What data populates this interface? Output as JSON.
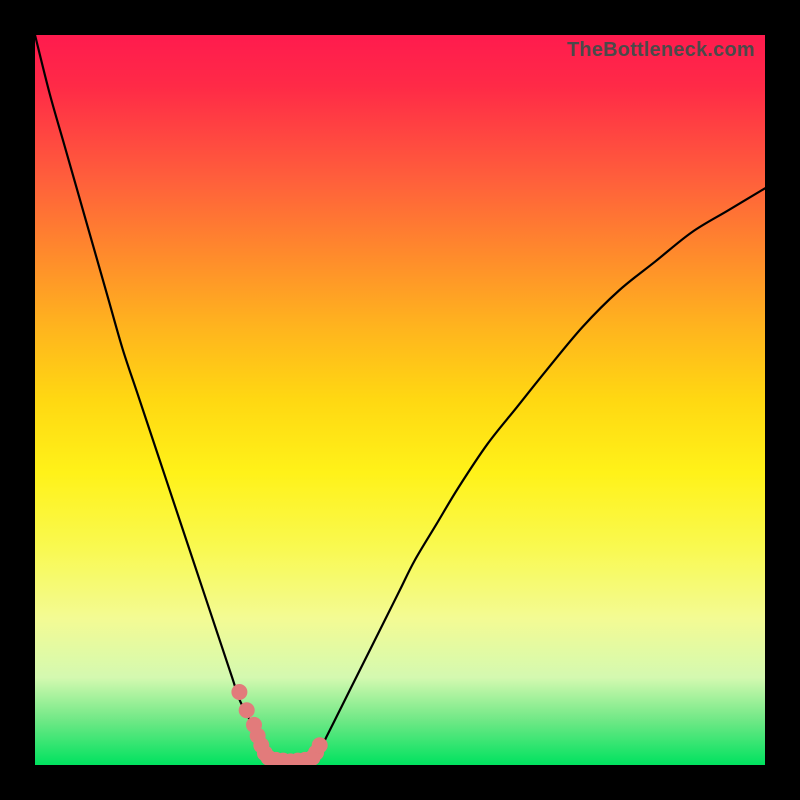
{
  "watermark": "TheBottleneck.com",
  "chart_data": {
    "type": "line",
    "title": "",
    "xlabel": "",
    "ylabel": "",
    "xlim": [
      0,
      100
    ],
    "ylim": [
      0,
      100
    ],
    "grid": false,
    "series": [
      {
        "name": "left-branch",
        "x": [
          0,
          2,
          4,
          6,
          8,
          10,
          12,
          14,
          16,
          18,
          20,
          22,
          24,
          25,
          26,
          27,
          28,
          29,
          30,
          30.5,
          31,
          31.5,
          32
        ],
        "values": [
          100,
          92,
          85,
          78,
          71,
          64,
          57,
          51,
          45,
          39,
          33,
          27,
          21,
          18,
          15,
          12,
          9,
          7,
          5,
          3.5,
          2.5,
          1.5,
          1
        ]
      },
      {
        "name": "right-branch",
        "x": [
          38,
          39,
          40,
          41,
          42,
          44,
          46,
          48,
          50,
          52,
          55,
          58,
          62,
          66,
          70,
          75,
          80,
          85,
          90,
          95,
          100
        ],
        "values": [
          1,
          2,
          4,
          6,
          8,
          12,
          16,
          20,
          24,
          28,
          33,
          38,
          44,
          49,
          54,
          60,
          65,
          69,
          73,
          76,
          79
        ]
      }
    ],
    "valley_floor": {
      "x_start": 32,
      "x_end": 38,
      "value": 0.5
    },
    "highlight_dots": {
      "color": "#e27b7b",
      "radius_px": 8,
      "points": [
        {
          "x": 28,
          "y": 10
        },
        {
          "x": 29,
          "y": 7.5
        },
        {
          "x": 30,
          "y": 5.5
        },
        {
          "x": 30.5,
          "y": 4
        },
        {
          "x": 31,
          "y": 2.7
        },
        {
          "x": 31.5,
          "y": 1.6
        },
        {
          "x": 32,
          "y": 1
        },
        {
          "x": 33,
          "y": 0.7
        },
        {
          "x": 34,
          "y": 0.6
        },
        {
          "x": 35,
          "y": 0.5
        },
        {
          "x": 36,
          "y": 0.6
        },
        {
          "x": 37,
          "y": 0.7
        },
        {
          "x": 38,
          "y": 1
        },
        {
          "x": 38.5,
          "y": 1.7
        },
        {
          "x": 39,
          "y": 2.7
        }
      ]
    },
    "gradient_stops": [
      {
        "pos": 0.0,
        "color": "#ff1b4e"
      },
      {
        "pos": 0.2,
        "color": "#ff603b"
      },
      {
        "pos": 0.4,
        "color": "#ffb41e"
      },
      {
        "pos": 0.6,
        "color": "#fff219"
      },
      {
        "pos": 0.8,
        "color": "#f3fb94"
      },
      {
        "pos": 0.94,
        "color": "#6de885"
      },
      {
        "pos": 1.0,
        "color": "#00e25f"
      }
    ]
  }
}
